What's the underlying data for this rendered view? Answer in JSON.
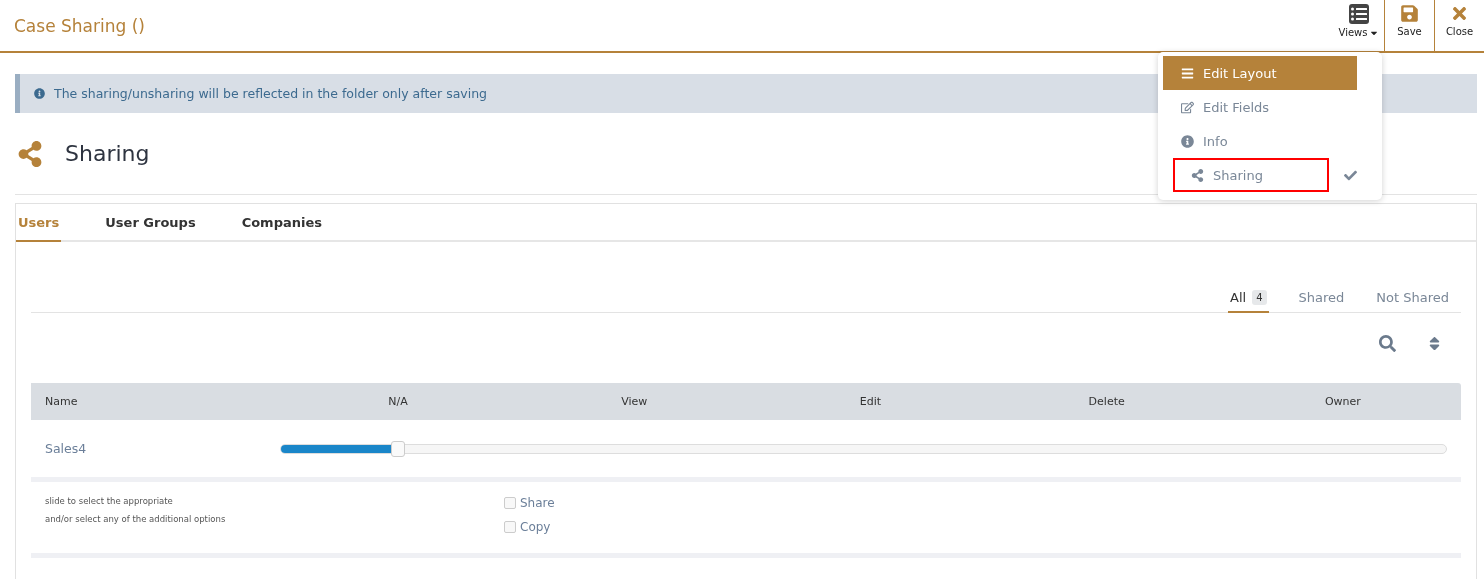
{
  "header": {
    "title": "Case Sharing ()",
    "actions": [
      {
        "kind": "views",
        "label": "Views"
      },
      {
        "kind": "save",
        "label": "Save"
      },
      {
        "kind": "close",
        "label": "Close"
      }
    ]
  },
  "views_menu": [
    {
      "kind": "layout",
      "label": "Edit Layout",
      "highlighted": true,
      "checked": false,
      "marked": false
    },
    {
      "kind": "fields",
      "label": "Edit Fields",
      "highlighted": false,
      "checked": false,
      "marked": false
    },
    {
      "kind": "info",
      "label": "Info",
      "highlighted": false,
      "checked": false,
      "marked": false
    },
    {
      "kind": "sharing",
      "label": "Sharing",
      "highlighted": false,
      "checked": true,
      "marked": true
    }
  ],
  "alert": {
    "text": "The sharing/unsharing will be reflected in the folder only after saving"
  },
  "section": {
    "title": "Sharing"
  },
  "tabs": [
    {
      "label": "Users",
      "selected": true
    },
    {
      "label": "User Groups",
      "selected": false
    },
    {
      "label": "Companies",
      "selected": false
    }
  ],
  "filters": [
    {
      "label": "All",
      "count": "4",
      "selected": true
    },
    {
      "label": "Shared",
      "selected": false
    },
    {
      "label": "Not Shared",
      "selected": false
    }
  ],
  "table": {
    "columns": [
      "Name",
      "N/A",
      "View",
      "Edit",
      "Delete",
      "Owner"
    ],
    "rows": [
      {
        "name": "Sales4",
        "level": 0.1
      }
    ]
  },
  "options": {
    "hint_lines": [
      "slide to select the appropriate",
      "and/or select any of the additional options"
    ],
    "checkboxes": [
      {
        "label": "Share",
        "checked": false
      },
      {
        "label": "Copy",
        "checked": false
      }
    ]
  }
}
